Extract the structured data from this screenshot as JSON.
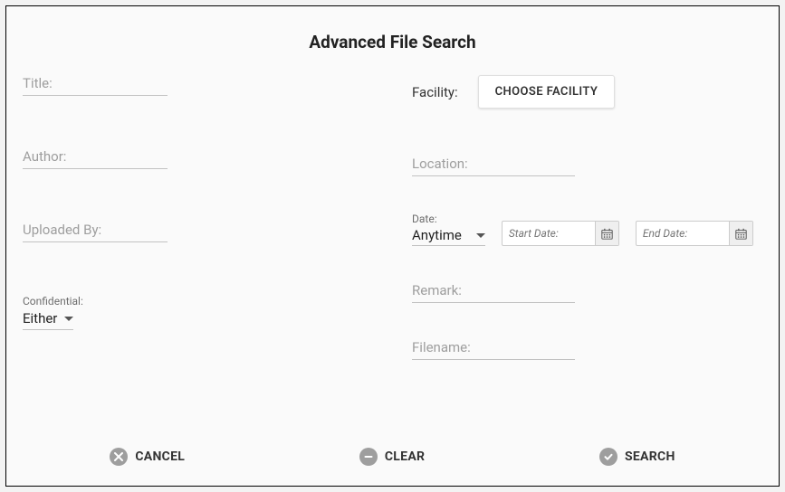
{
  "title": "Advanced File Search",
  "left": {
    "title_label": "Title:",
    "author_label": "Author:",
    "uploaded_by_label": "Uploaded By:",
    "confidential": {
      "label": "Confidential:",
      "value": "Either"
    }
  },
  "right": {
    "facility": {
      "label": "Facility:",
      "button": "CHOOSE FACILITY"
    },
    "location_label": "Location:",
    "date": {
      "label": "Date:",
      "value": "Anytime",
      "start_placeholder": "Start Date:",
      "end_placeholder": "End Date:"
    },
    "remark_label": "Remark:",
    "filename_label": "Filename:"
  },
  "actions": {
    "cancel": "CANCEL",
    "clear": "CLEAR",
    "search": "SEARCH"
  }
}
